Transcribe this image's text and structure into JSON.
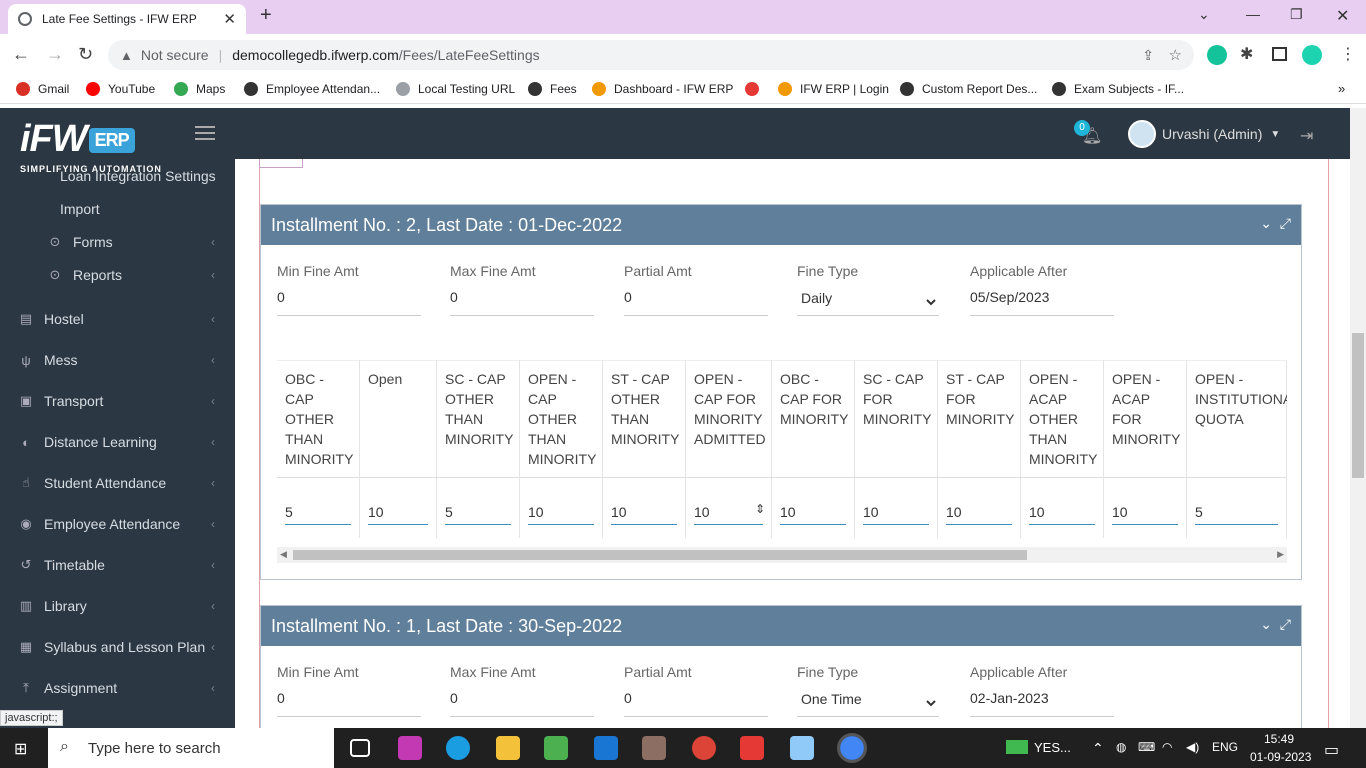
{
  "browser": {
    "tab_title": "Late Fee Settings - IFW ERP",
    "security_label": "Not secure",
    "url_host": "democollegedb.ifwerp.com",
    "url_path": "/Fees/LateFeeSettings",
    "bookmarks": [
      {
        "label": "Gmail",
        "color": "#d93025"
      },
      {
        "label": "YouTube",
        "color": "#ff0000"
      },
      {
        "label": "Maps",
        "color": "#34a853"
      },
      {
        "label": "Employee Attendan...",
        "color": "#333333"
      },
      {
        "label": "Local Testing URL",
        "color": "#9aa0a6"
      },
      {
        "label": "Fees",
        "color": "#333333"
      },
      {
        "label": "Dashboard - IFW ERP",
        "color": "#f29900"
      },
      {
        "label": "",
        "color": "#e53935"
      },
      {
        "label": "IFW ERP | Login",
        "color": "#f29900"
      },
      {
        "label": "Custom Report Des...",
        "color": "#333333"
      },
      {
        "label": "Exam Subjects - IF...",
        "color": "#333333"
      }
    ]
  },
  "app": {
    "logo_text": "iFW",
    "logo_badge": "ERP",
    "logo_tagline": "SIMPLIFYING AUTOMATION",
    "notification_count": "0",
    "user_name": "Urvashi (Admin)"
  },
  "sidebar": {
    "items": [
      {
        "label": "Loan Integration Settings",
        "type": "sub"
      },
      {
        "label": "Import",
        "type": "sub"
      },
      {
        "label": "Forms",
        "type": "sub2"
      },
      {
        "label": "Reports",
        "type": "sub2"
      },
      {
        "label": "Hostel",
        "type": "main"
      },
      {
        "label": "Mess",
        "type": "main"
      },
      {
        "label": "Transport",
        "type": "main"
      },
      {
        "label": "Distance Learning",
        "type": "main"
      },
      {
        "label": "Student Attendance",
        "type": "main"
      },
      {
        "label": "Employee Attendance",
        "type": "main"
      },
      {
        "label": "Timetable",
        "type": "main"
      },
      {
        "label": "Library",
        "type": "main"
      },
      {
        "label": "Syllabus and Lesson Plan",
        "type": "main"
      },
      {
        "label": "Assignment",
        "type": "main"
      }
    ]
  },
  "field_labels": {
    "min": "Min Fine Amt",
    "max": "Max Fine Amt",
    "partial": "Partial Amt",
    "fine_type": "Fine Type",
    "applicable": "Applicable After"
  },
  "installment2": {
    "title": "Installment No. : 2, Last Date : 01-Dec-2022",
    "min": "0",
    "max": "0",
    "partial": "0",
    "fine_type": "Daily",
    "applicable": "05/Sep/2023",
    "columns": [
      {
        "h": "OBC - CAP OTHER THAN MINORITY",
        "v": "5"
      },
      {
        "h": "Open",
        "v": "10"
      },
      {
        "h": "SC - CAP OTHER THAN MINORITY",
        "v": "5"
      },
      {
        "h": "OPEN - CAP OTHER THAN MINORITY",
        "v": "10"
      },
      {
        "h": "ST - CAP OTHER THAN MINORITY",
        "v": "10"
      },
      {
        "h": "OPEN - CAP FOR MINORITY ADMITTED",
        "v": "10"
      },
      {
        "h": "OBC - CAP FOR MINORITY",
        "v": "10"
      },
      {
        "h": "SC - CAP FOR MINORITY",
        "v": "10"
      },
      {
        "h": "ST - CAP FOR MINORITY",
        "v": "10"
      },
      {
        "h": "OPEN - ACAP OTHER THAN MINORITY",
        "v": "10"
      },
      {
        "h": "OPEN - ACAP FOR MINORITY",
        "v": "10"
      },
      {
        "h": "OPEN - INSTITUTIONAL QUOTA",
        "v": "5"
      }
    ]
  },
  "installment1": {
    "title": "Installment No. : 1, Last Date : 30-Sep-2022",
    "min": "0",
    "max": "0",
    "partial": "0",
    "fine_type": "One Time",
    "applicable": "02-Jan-2023"
  },
  "status_text": "javascript:;",
  "taskbar": {
    "search_placeholder": "Type here to search",
    "weather": "YES...",
    "lang": "ENG",
    "time": "15:49",
    "date": "01-09-2023"
  }
}
